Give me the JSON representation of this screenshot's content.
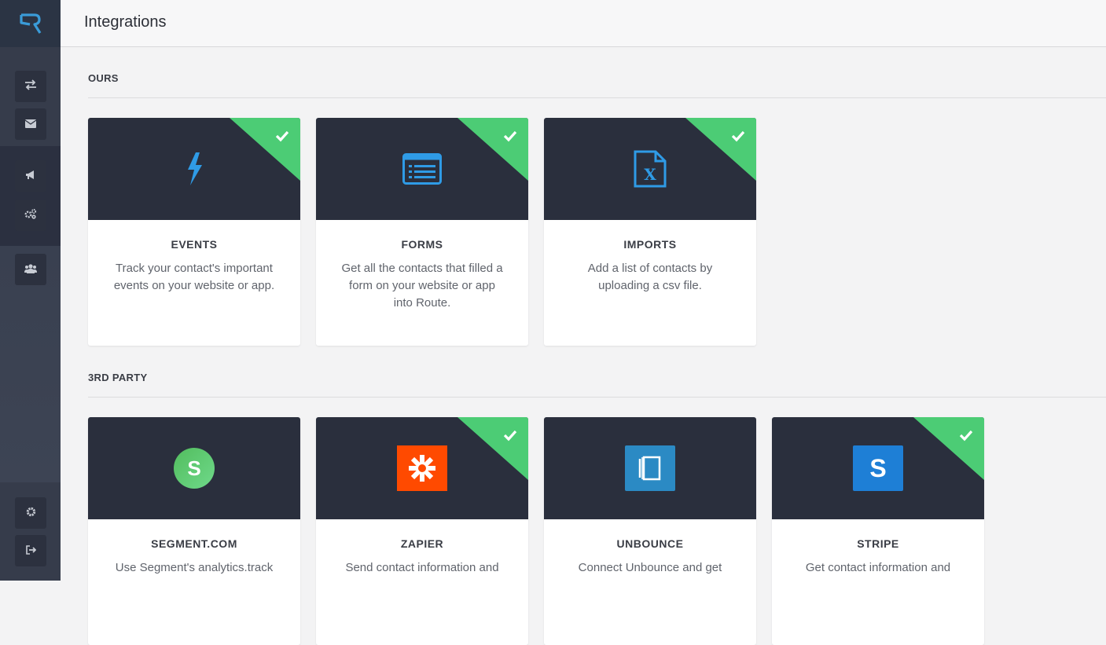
{
  "header": {
    "title": "Integrations"
  },
  "sections": {
    "ours": "OURS",
    "third_party": "3RD PARTY"
  },
  "sidebar": {
    "items": [
      {
        "name": "transfer-icon",
        "glyph": "⇄"
      },
      {
        "name": "envelope-icon",
        "glyph": "✉"
      },
      {
        "name": "megaphone-icon",
        "glyph": "📢"
      },
      {
        "name": "cogs-icon",
        "glyph": "⚙"
      },
      {
        "name": "users-icon",
        "glyph": "👥"
      },
      {
        "name": "settings-icon",
        "glyph": "⚙"
      },
      {
        "name": "sign-out-icon",
        "glyph": "⇥"
      }
    ]
  },
  "ours_cards": [
    {
      "title": "EVENTS",
      "description": "Track your contact's important events on your website or app.",
      "enabled": true,
      "icon": "bolt-icon"
    },
    {
      "title": "FORMS",
      "description": "Get all the contacts that filled a form on your website or app into Route.",
      "enabled": true,
      "icon": "form-icon"
    },
    {
      "title": "IMPORTS",
      "description": "Add a list of contacts by uploading a csv file.",
      "enabled": true,
      "icon": "excel-file-icon"
    }
  ],
  "third_party_cards": [
    {
      "title": "SEGMENT.COM",
      "description": "Use Segment's analytics.track",
      "enabled": false,
      "icon": "segment-logo-icon",
      "logo_letter": "S"
    },
    {
      "title": "ZAPIER",
      "description": "Send contact information and",
      "enabled": true,
      "icon": "zapier-logo-icon"
    },
    {
      "title": "UNBOUNCE",
      "description": "Connect Unbounce and get",
      "enabled": false,
      "icon": "unbounce-logo-icon"
    },
    {
      "title": "STRIPE",
      "description": "Get contact information and",
      "enabled": true,
      "icon": "stripe-logo-icon",
      "logo_letter": "S"
    }
  ],
  "colors": {
    "accent_green": "#4ccc75",
    "icon_blue": "#2f9be6",
    "card_dark": "#2a2f3d",
    "zapier_orange": "#ff4a00",
    "stripe_blue": "#1e7fd6",
    "unbounce_blue": "#2b8ac4"
  }
}
